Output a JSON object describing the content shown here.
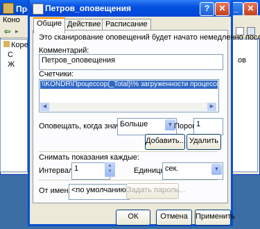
{
  "background_window": {
    "title_partial": "Про",
    "menu_partial": "Коно",
    "tree_items": [
      "Коре",
      "С",
      "Ж"
    ],
    "list_item_partial": "ов"
  },
  "dialog": {
    "title": "Петров_оповещения",
    "title_buttons": {
      "help": "?",
      "close": "✕"
    },
    "tabs": [
      "Общие",
      "Действие",
      "Расписание"
    ],
    "active_tab": "Общие",
    "info_text": "Это сканирование оповещений будет начато немедленно после",
    "comment_label": "Комментарий:",
    "comment_value": "Петров_оповещения",
    "counters_label": "Счетчики:",
    "counters": [
      "\\\\KONDR\\Процессор(_Total)\\% загруженности процессора"
    ],
    "alert_when_label": "Оповещать, когда значение:",
    "alert_when_value": "Больше",
    "threshold_label": "Порог:",
    "threshold_value": "1",
    "add_button": "Добавить...",
    "remove_button": "Удалить",
    "sample_label": "Снимать показания каждые:",
    "interval_label": "Интервал:",
    "interval_value": "1",
    "units_label": "Единицы:",
    "units_value": "сек.",
    "run_as_label": "От имени:",
    "run_as_value": "<по умолчанию>",
    "set_password_button": "Задать пароль...",
    "ok_button": "ОК",
    "cancel_button": "Отмена",
    "apply_button": "Применить"
  },
  "colors": {
    "accent": "#316ac5",
    "titlebar": "#0550e0",
    "active_tab_highlight": "#ff8c00"
  }
}
